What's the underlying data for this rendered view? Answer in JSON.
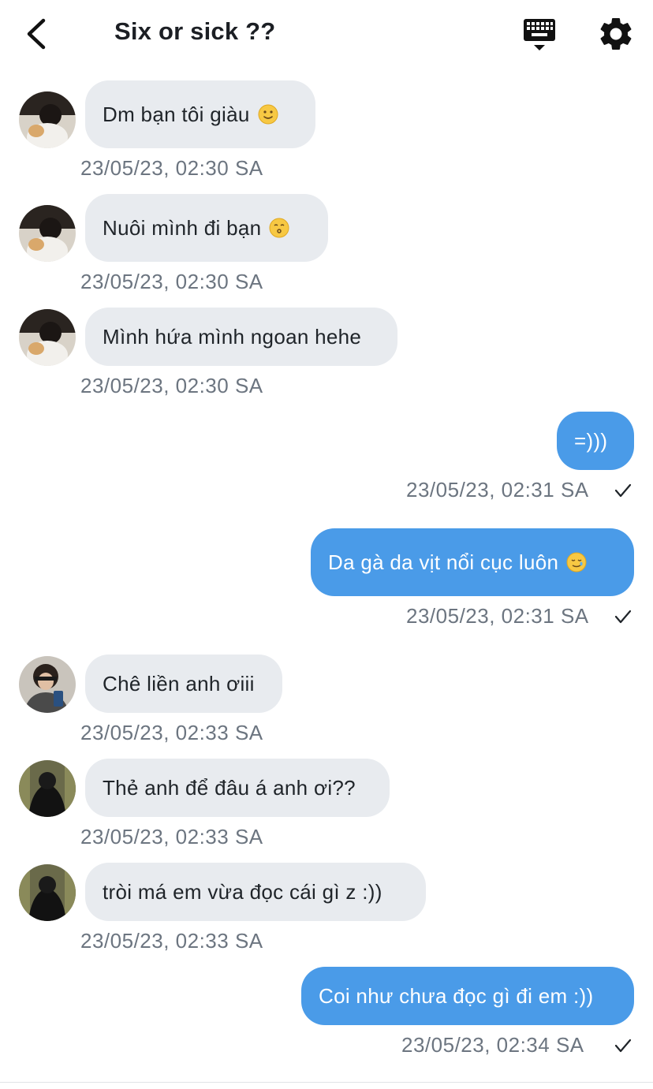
{
  "header": {
    "title": "Six or sick ??",
    "icons": [
      "back-arrow-icon",
      "keyboard-icon",
      "gear-icon"
    ]
  },
  "messages": [
    {
      "direction": "incoming",
      "text": "Dm bạn tôi giàu",
      "emoji": "slightly-smiling-face",
      "timestamp": "23/05/23, 02:30 SA"
    },
    {
      "direction": "incoming",
      "text": "Nuôi mình đi bạn",
      "emoji": "kissing-face",
      "timestamp": "23/05/23, 02:30 SA"
    },
    {
      "direction": "incoming",
      "text": "Mình hứa mình ngoan hehe",
      "timestamp": "23/05/23, 02:30 SA"
    },
    {
      "direction": "outgoing",
      "text": "=)))",
      "timestamp": "23/05/23, 02:31 SA",
      "status": "sent-check"
    },
    {
      "direction": "outgoing",
      "text": "Da gà da vịt nổi cục luôn",
      "emoji": "smiling-face-with-tear",
      "timestamp": "23/05/23, 02:31 SA",
      "status": "sent-check"
    },
    {
      "direction": "incoming",
      "text": "Chê liền anh ơiii",
      "timestamp": "23/05/23, 02:33 SA"
    },
    {
      "direction": "incoming",
      "text": "Thẻ anh để đâu á anh ơi??",
      "timestamp": "23/05/23, 02:33 SA"
    },
    {
      "direction": "incoming",
      "text": "tròi má em vừa đọc cái gì z :))",
      "timestamp": "23/05/23, 02:33 SA"
    },
    {
      "direction": "outgoing",
      "text": "Coi như chưa đọc gì đi em :))",
      "timestamp": "23/05/23, 02:34 SA",
      "status": "sent-check"
    }
  ],
  "colors": {
    "incoming_bubble": "#e8ebef",
    "outgoing_bubble": "#4a9be8",
    "timestamp": "#6c7580",
    "title": "#1c1f24"
  }
}
